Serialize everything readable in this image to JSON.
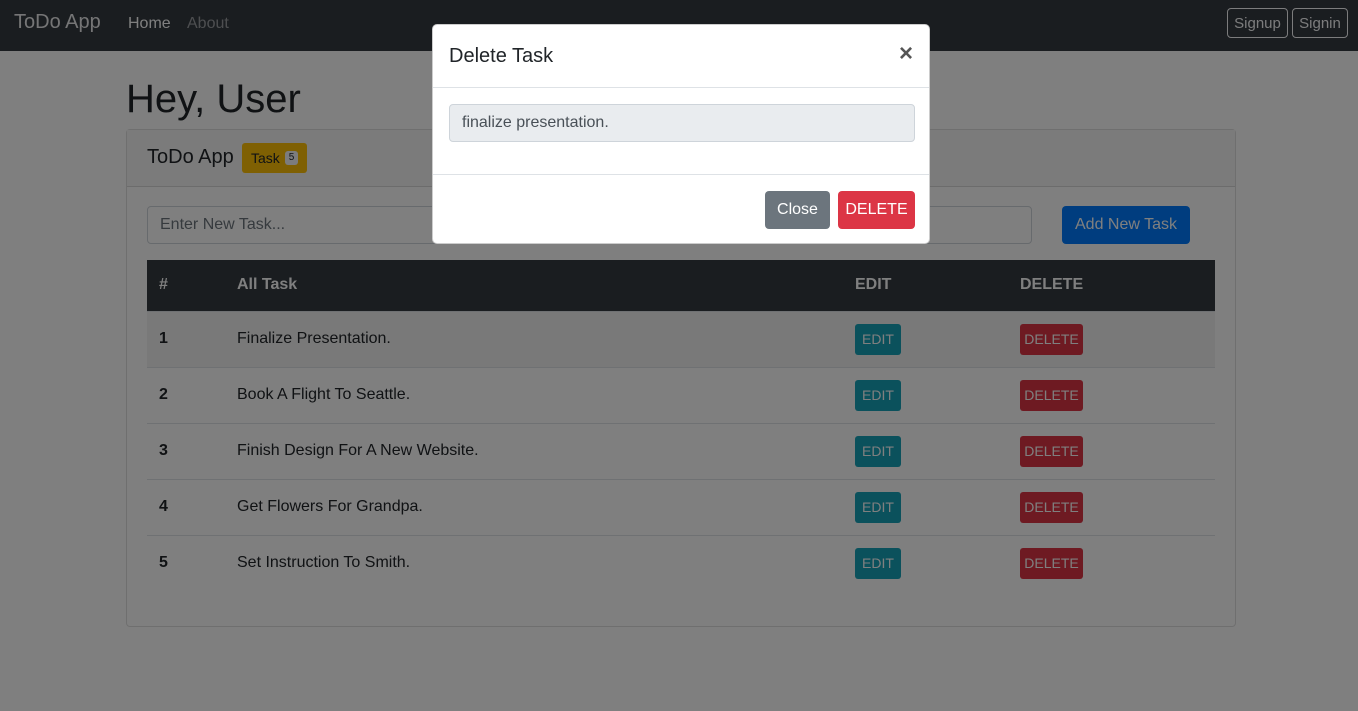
{
  "navbar": {
    "brand": "ToDo App",
    "home": "Home",
    "about": "About",
    "signup": "Signup",
    "signin": "Signin"
  },
  "main": {
    "greeting": "Hey, User",
    "card_title": "ToDo App",
    "badge_label": "Task",
    "badge_count": "5",
    "input_placeholder": "Enter New Task...",
    "add_button": "Add New Task"
  },
  "table": {
    "headers": [
      "#",
      "All Task",
      "EDIT",
      "DELETE"
    ],
    "rows": [
      {
        "num": "1",
        "task": "Finalize Presentation.",
        "edit": "EDIT",
        "delete": "DELETE"
      },
      {
        "num": "2",
        "task": "Book A Flight To Seattle.",
        "edit": "EDIT",
        "delete": "DELETE"
      },
      {
        "num": "3",
        "task": "Finish Design For A New Website.",
        "edit": "EDIT",
        "delete": "DELETE"
      },
      {
        "num": "4",
        "task": "Get Flowers For Grandpa.",
        "edit": "EDIT",
        "delete": "DELETE"
      },
      {
        "num": "5",
        "task": "Set Instruction To Smith.",
        "edit": "EDIT",
        "delete": "DELETE"
      }
    ]
  },
  "modal": {
    "title": "Delete Task",
    "close_symbol": "×",
    "input_value": "finalize presentation.",
    "close_button": "Close",
    "delete_button": "DELETE"
  },
  "colors": {
    "navbar": "#343a40",
    "primary": "#007bff",
    "info": "#17a2b8",
    "danger": "#dc3545",
    "warning": "#ffc107",
    "secondary": "#6c757d"
  }
}
